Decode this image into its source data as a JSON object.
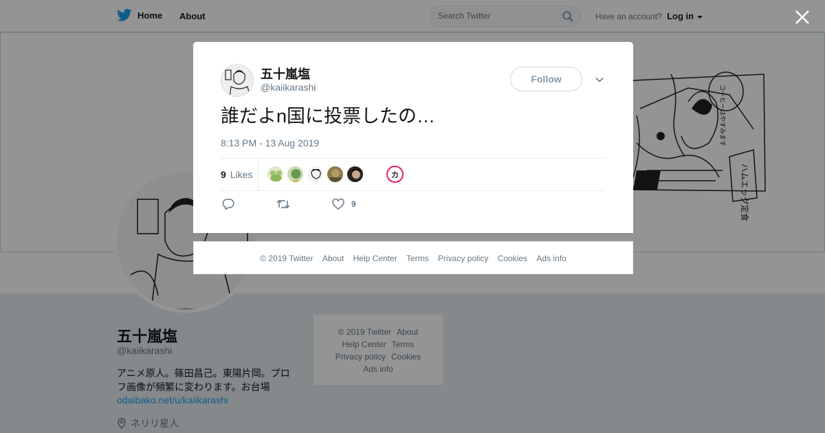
{
  "topbar": {
    "home_label": "Home",
    "about_label": "About",
    "search_placeholder": "Search Twitter",
    "account_prompt": "Have an account?",
    "login_label": "Log in"
  },
  "profile": {
    "name": "五十嵐塩",
    "handle": "@kaiikarashi",
    "bio": "アニメ原人。篠田昌己。東陽片岡。プロフ画像が頻繁に変わります。お台場",
    "link": "odaibako.net/u/kaiikarashi",
    "location": "ネリリ星人"
  },
  "side_footer": {
    "items": [
      "© 2019 Twitter",
      "About",
      "Help Center",
      "Terms",
      "Privacy policy",
      "Cookies",
      "Ads info"
    ]
  },
  "header_art": {
    "speech_bubble": "コーヒーはやすみます",
    "sign": "ハムエッグ定食"
  },
  "tweet": {
    "author_name": "五十嵐塩",
    "author_handle": "@kaiikarashi",
    "follow_label": "Follow",
    "text": "誰だよn国に投票したの…",
    "timestamp": "8:13 PM - 13 Aug 2019",
    "likes_count": "9",
    "likes_label": "Likes",
    "like_action_count": "9",
    "liker_badge": "カ"
  },
  "modal_footer": {
    "items": [
      "© 2019 Twitter",
      "About",
      "Help Center",
      "Terms",
      "Privacy policy",
      "Cookies",
      "Ads info"
    ]
  },
  "colors": {
    "accent": "#1da1f2",
    "text_primary": "#14171a",
    "text_secondary": "#657786",
    "border": "#e6ecf0",
    "liker_badge": "#e0245e"
  },
  "icons": [
    "twitter-bird-icon",
    "search-icon",
    "caret-down-icon",
    "close-icon",
    "chevron-down-icon",
    "reply-icon",
    "retweet-icon",
    "heart-icon",
    "location-pin-icon"
  ]
}
